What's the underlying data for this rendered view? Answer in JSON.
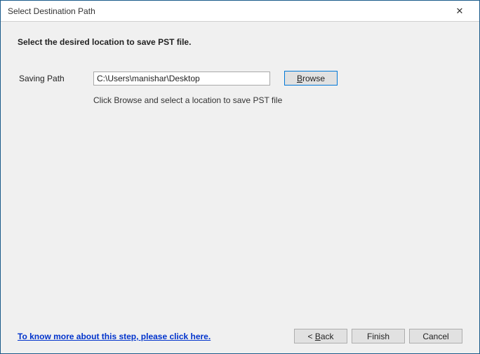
{
  "window": {
    "title": "Select Destination Path"
  },
  "content": {
    "instruction": "Select the desired location to save PST file.",
    "saving_path_label": "Saving Path",
    "saving_path_value": "C:\\Users\\manishar\\Desktop",
    "browse_label_prefix": "B",
    "browse_label_rest": "rowse",
    "hint": "Click Browse and select a location to save PST file"
  },
  "footer": {
    "help_link": "To know more about this step, please click here.",
    "back_prefix": "< ",
    "back_u": "B",
    "back_rest": "ack",
    "finish_label": "Finish",
    "cancel_label": "Cancel"
  }
}
